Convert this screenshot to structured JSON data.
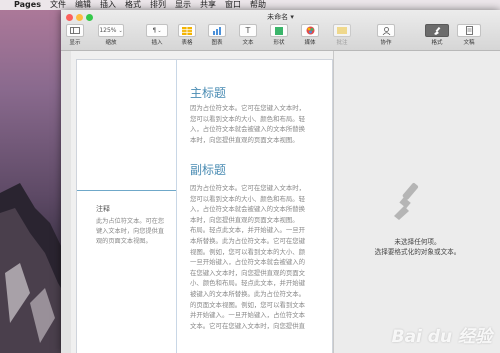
{
  "menubar": {
    "app": "Pages",
    "items": [
      "文件",
      "编辑",
      "插入",
      "格式",
      "排列",
      "显示",
      "共享",
      "窗口",
      "帮助"
    ]
  },
  "window": {
    "title": "未命名 ▾"
  },
  "toolbar": {
    "view_label": "显示",
    "zoom_value": "125%",
    "zoom_label": "缩放",
    "insert_label": "插入",
    "table_label": "表格",
    "chart_label": "图表",
    "text_label": "文本",
    "shape_label": "形状",
    "media_label": "媒体",
    "comment_label": "批注",
    "collaborate_label": "协作",
    "format_label": "格式",
    "document_label": "文稿"
  },
  "document": {
    "heading1": "主标题",
    "body1": "因为占位符文本。它可在您键入文本时，\n您可以看到文本的大小、颜色和布局。轻\n入，占位符文本就会被键入的文本所替换\n本时，向您提供直观的页面文本视图。",
    "heading2": "副标题",
    "body2": "因为占位符文本。它可在您键入文本时，\n您可以看到文本的大小、颜色和布局。轻\n入，占位符文本就会被键入的文本所替换\n本时，向您提供直观的页面文本视图。\n布局。轻点此文本，并开始键入。一旦开\n本所替换。此为占位符文本。它可在您键\n视图。例如，您可以看到文本的大小、颜\n一旦开始键入，占位符文本就会被键入的\n在您键入文本时，向您提供直观的页面文\n小、颜色和布局。轻点此文本，并开始键\n被键入的文本所替换。此为占位符文本。\n的页面文本视图。例如，您可以看到文本\n并开始键入。一旦开始键入，占位符文本\n文本。它可在您键入文本时，向您提供直",
    "note_title": "注释",
    "note_body": "此为占位符文本。可在您\n键入文本时，向您提供直\n观的页面文本视图。"
  },
  "inspector": {
    "line1": "未选择任何项。",
    "line2": "选择要格式化的对象或文本。"
  },
  "watermark": "Bai du 经验",
  "colors": {
    "accent": "#4a8cb3",
    "close": "#fc605c",
    "minimize": "#fdbc40",
    "zoom": "#34c84a"
  }
}
